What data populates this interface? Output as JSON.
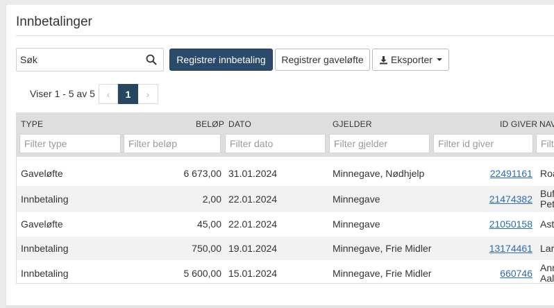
{
  "page": {
    "title": "Innbetalinger"
  },
  "search": {
    "value": "Søk",
    "icon": "search-icon"
  },
  "buttons": {
    "register_payment": "Registrer innbetaling",
    "register_pledge": "Registrer gaveløfte",
    "export": "Eksporter"
  },
  "pager": {
    "info": "Viser 1 - 5 av 5",
    "prev": "‹",
    "current": "1",
    "next": "›"
  },
  "table": {
    "columns": {
      "type": "TYPE",
      "amount": "BELØP",
      "date": "DATO",
      "applies": "GJELDER",
      "giver_id": "ID GIVER",
      "name": "NAV"
    },
    "filters": {
      "type": "Filter type",
      "amount": "Filter beløp",
      "date": "Filter dato",
      "applies": "Filter gjelder",
      "giver_id": "Filter id giver",
      "name": "Filte"
    },
    "rows": [
      {
        "type": "Gaveløfte",
        "amount": "6 673,00",
        "date": "31.01.2024",
        "applies": "Minnegave, Nødhjelp",
        "giver_id": "22491161",
        "name1": "Roa",
        "name2": ""
      },
      {
        "type": "Innbetaling",
        "amount": "2,00",
        "date": "22.01.2024",
        "applies": "Minnegave",
        "giver_id": "21474382",
        "name1": "Buf",
        "name2": "Pett"
      },
      {
        "type": "Gaveløfte",
        "amount": "45,00",
        "date": "22.01.2024",
        "applies": "Minnegave",
        "giver_id": "21050158",
        "name1": "Astr",
        "name2": ""
      },
      {
        "type": "Innbetaling",
        "amount": "750,00",
        "date": "19.01.2024",
        "applies": "Minnegave, Frie Midler",
        "giver_id": "13174461",
        "name1": "Lars",
        "name2": ""
      },
      {
        "type": "Innbetaling",
        "amount": "5 600,00",
        "date": "15.01.2024",
        "applies": "Minnegave, Frie Midler",
        "giver_id": "660746",
        "name1": "Ann",
        "name2": "Aale"
      }
    ]
  },
  "colors": {
    "primary": "#2c4a6b",
    "link": "#2a6bb5",
    "header_bg": "#dedede",
    "alt_row": "#f2f2f2"
  }
}
